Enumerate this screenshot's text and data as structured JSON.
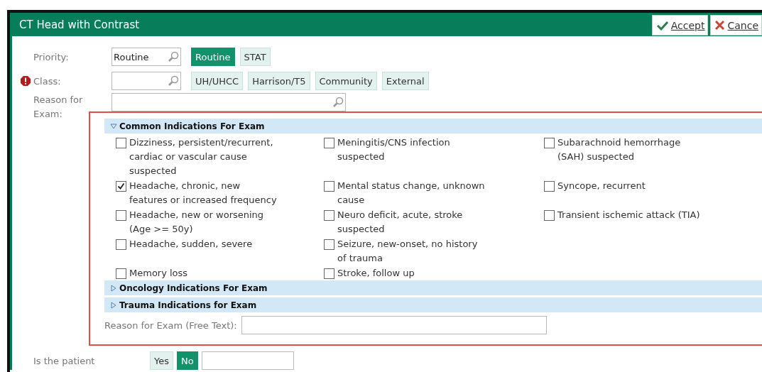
{
  "window": {
    "title": "CT Head with Contrast"
  },
  "actions": [
    {
      "kind": "accept",
      "label": "Accept"
    },
    {
      "kind": "cancel",
      "label": "Cance"
    }
  ],
  "priority": {
    "label": "Priority:",
    "value": "Routine",
    "options": [
      {
        "label": "Routine",
        "selected": true
      },
      {
        "label": "STAT",
        "selected": false
      }
    ]
  },
  "class": {
    "label": "Class:",
    "required": true,
    "options": [
      {
        "label": "UH/UHCC",
        "selected": false
      },
      {
        "label": "Harrison/T5",
        "selected": false
      },
      {
        "label": "Community",
        "selected": false
      },
      {
        "label": "External",
        "selected": false
      }
    ]
  },
  "reason": {
    "label": "Reason for Exam:"
  },
  "sections": [
    {
      "title": "Common Indications For Exam",
      "expanded": true,
      "items": [
        {
          "label": "Dizziness, persistent/recurrent, cardiac or vascular cause suspected",
          "checked": false
        },
        {
          "label": "Meningitis/CNS infection suspected",
          "checked": false
        },
        {
          "label": "Subarachnoid hemorrhage (SAH) suspected",
          "checked": false
        },
        {
          "label": "Headache, chronic, new features or increased frequency",
          "checked": true
        },
        {
          "label": "Mental status change, unknown cause",
          "checked": false
        },
        {
          "label": "Syncope, recurrent",
          "checked": false
        },
        {
          "label": "Headache, new or worsening (Age >= 50y)",
          "checked": false
        },
        {
          "label": "Neuro deficit, acute, stroke suspected",
          "checked": false
        },
        {
          "label": "Transient ischemic attack (TIA)",
          "checked": false
        },
        {
          "label": "Headache, sudden, severe",
          "checked": false
        },
        {
          "label": "Seizure, new-onset, no history of trauma",
          "checked": false
        },
        {
          "label": "Memory loss",
          "checked": false
        },
        {
          "label": "Stroke, follow up",
          "checked": false
        }
      ]
    },
    {
      "title": "Oncology Indications For Exam",
      "expanded": false
    },
    {
      "title": "Trauma Indications for Exam",
      "expanded": false
    }
  ],
  "free_text": {
    "label": "Reason for Exam (Free Text):"
  },
  "patient": {
    "label": "Is the patient",
    "options": [
      {
        "label": "Yes",
        "selected": false
      },
      {
        "label": "No",
        "selected": true
      }
    ]
  }
}
